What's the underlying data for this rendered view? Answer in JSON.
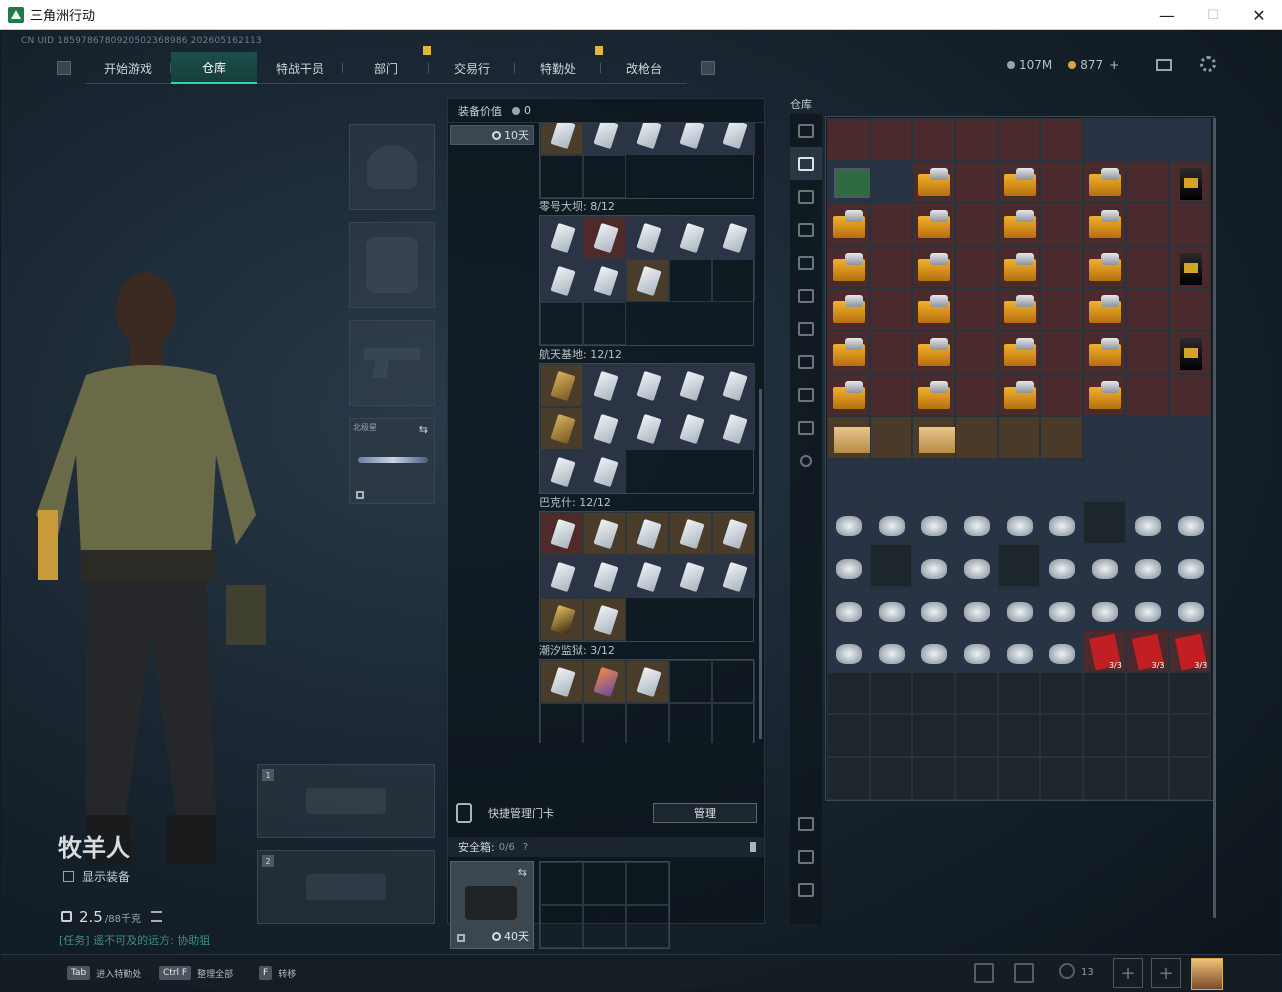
{
  "window": {
    "title": "三角洲行动",
    "controls": [
      "—",
      "☐",
      "✕"
    ]
  },
  "uid": "CN UID 1859786780920502368986 202605162113",
  "nav": {
    "tabs": [
      {
        "label": "开始游戏",
        "active": false,
        "badge": false
      },
      {
        "label": "仓库",
        "active": true,
        "badge": false
      },
      {
        "label": "特战干员",
        "active": false,
        "badge": false
      },
      {
        "label": "部门",
        "active": false,
        "badge": true
      },
      {
        "label": "交易行",
        "active": false,
        "badge": false
      },
      {
        "label": "特勤处",
        "active": false,
        "badge": true
      },
      {
        "label": "改枪台",
        "active": false,
        "badge": false
      }
    ]
  },
  "currency": {
    "silver": "107M",
    "gold": "877",
    "plus": "+"
  },
  "character": {
    "name": "牧羊人",
    "show_equipment": "显示装备",
    "weight_value": "2.5",
    "weight_max": "/88千克",
    "quest": "[任务] 遥不可及的远方: 协助狙"
  },
  "slots": {
    "melee_label": "北极星",
    "primary_1": "1",
    "primary_2": "2"
  },
  "middle": {
    "equipment_value_label": "装备价值",
    "equipment_value": "0",
    "keycard_days": "10天",
    "regions": [
      {
        "title": "零号大坝: 8/12"
      },
      {
        "title": "航天基地: 12/12"
      },
      {
        "title": "巴克什: 12/12"
      },
      {
        "title": "潮汐监狱: 3/12"
      }
    ],
    "quick_manage": "快捷管理门卡",
    "manage_button": "管理",
    "safe_label": "安全箱:",
    "safe_count": "0/6",
    "safe_help": "?",
    "safe_days": "40天"
  },
  "warehouse": {
    "title": "仓库",
    "count_label": "3/3"
  },
  "bottom": {
    "hints": [
      {
        "key": "Tab",
        "label": "进入特勤处"
      },
      {
        "key": "Ctrl F",
        "label": "整理全部"
      },
      {
        "key": "F",
        "label": "转移"
      }
    ],
    "team_count": "13"
  }
}
